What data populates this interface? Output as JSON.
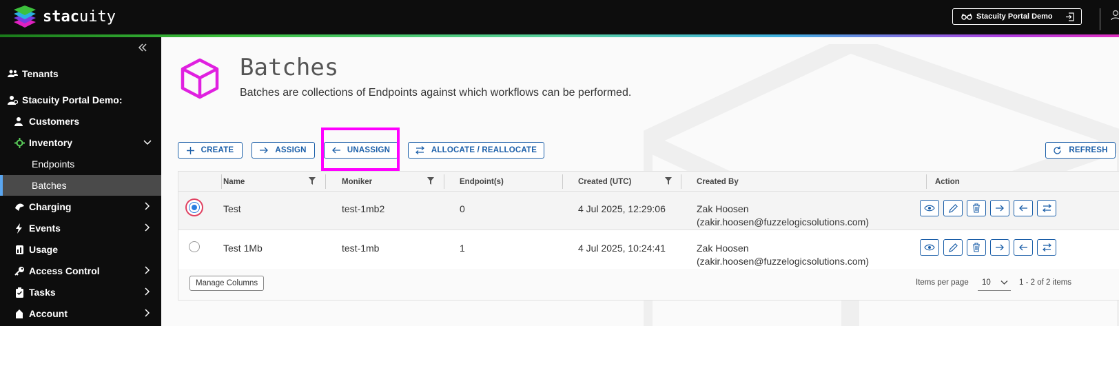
{
  "app": {
    "brand_bold": "stac",
    "brand_rest": "uity"
  },
  "header": {
    "tenant_button": "Stacuity Portal Demo"
  },
  "sidebar": {
    "tenants": "Tenants",
    "org": "Stacuity Portal Demo:",
    "customers": "Customers",
    "inventory": "Inventory",
    "endpoints": "Endpoints",
    "batches": "Batches",
    "charging": "Charging",
    "events": "Events",
    "usage": "Usage",
    "access_control": "Access Control",
    "tasks": "Tasks",
    "account": "Account"
  },
  "page": {
    "title": "Batches",
    "subtitle": "Batches are collections of Endpoints against which workflows can be performed."
  },
  "toolbar": {
    "create": "CREATE",
    "assign": "ASSIGN",
    "unassign": "UNASSIGN",
    "allocate": "ALLOCATE / REALLOCATE",
    "refresh": "REFRESH"
  },
  "table": {
    "columns": [
      "Name",
      "Moniker",
      "Endpoint(s)",
      "Created (UTC)",
      "Created By",
      "Action"
    ],
    "rows": [
      {
        "name": "Test",
        "moniker": "test-1mb2",
        "endpoints": "0",
        "created": "4 Jul 2025, 12:29:06",
        "by_name": "Zak Hoosen",
        "by_email": "(zakir.hoosen@fuzzelogicsolutions.com)",
        "selected": true
      },
      {
        "name": "Test 1Mb",
        "moniker": "test-1mb",
        "endpoints": "1",
        "created": "4 Jul 2025, 10:24:41",
        "by_name": "Zak Hoosen",
        "by_email": "(zakir.hoosen@fuzzelogicsolutions.com)",
        "selected": false
      }
    ]
  },
  "footer": {
    "manage_columns": "Manage Columns",
    "items_per_page_label": "Items per page",
    "items_per_page": "10",
    "range": "1 - 2 of 2 items"
  },
  "colors": {
    "accent": "#1a5ea8",
    "highlight": "#ff00ff",
    "cube": "#e020e0"
  }
}
